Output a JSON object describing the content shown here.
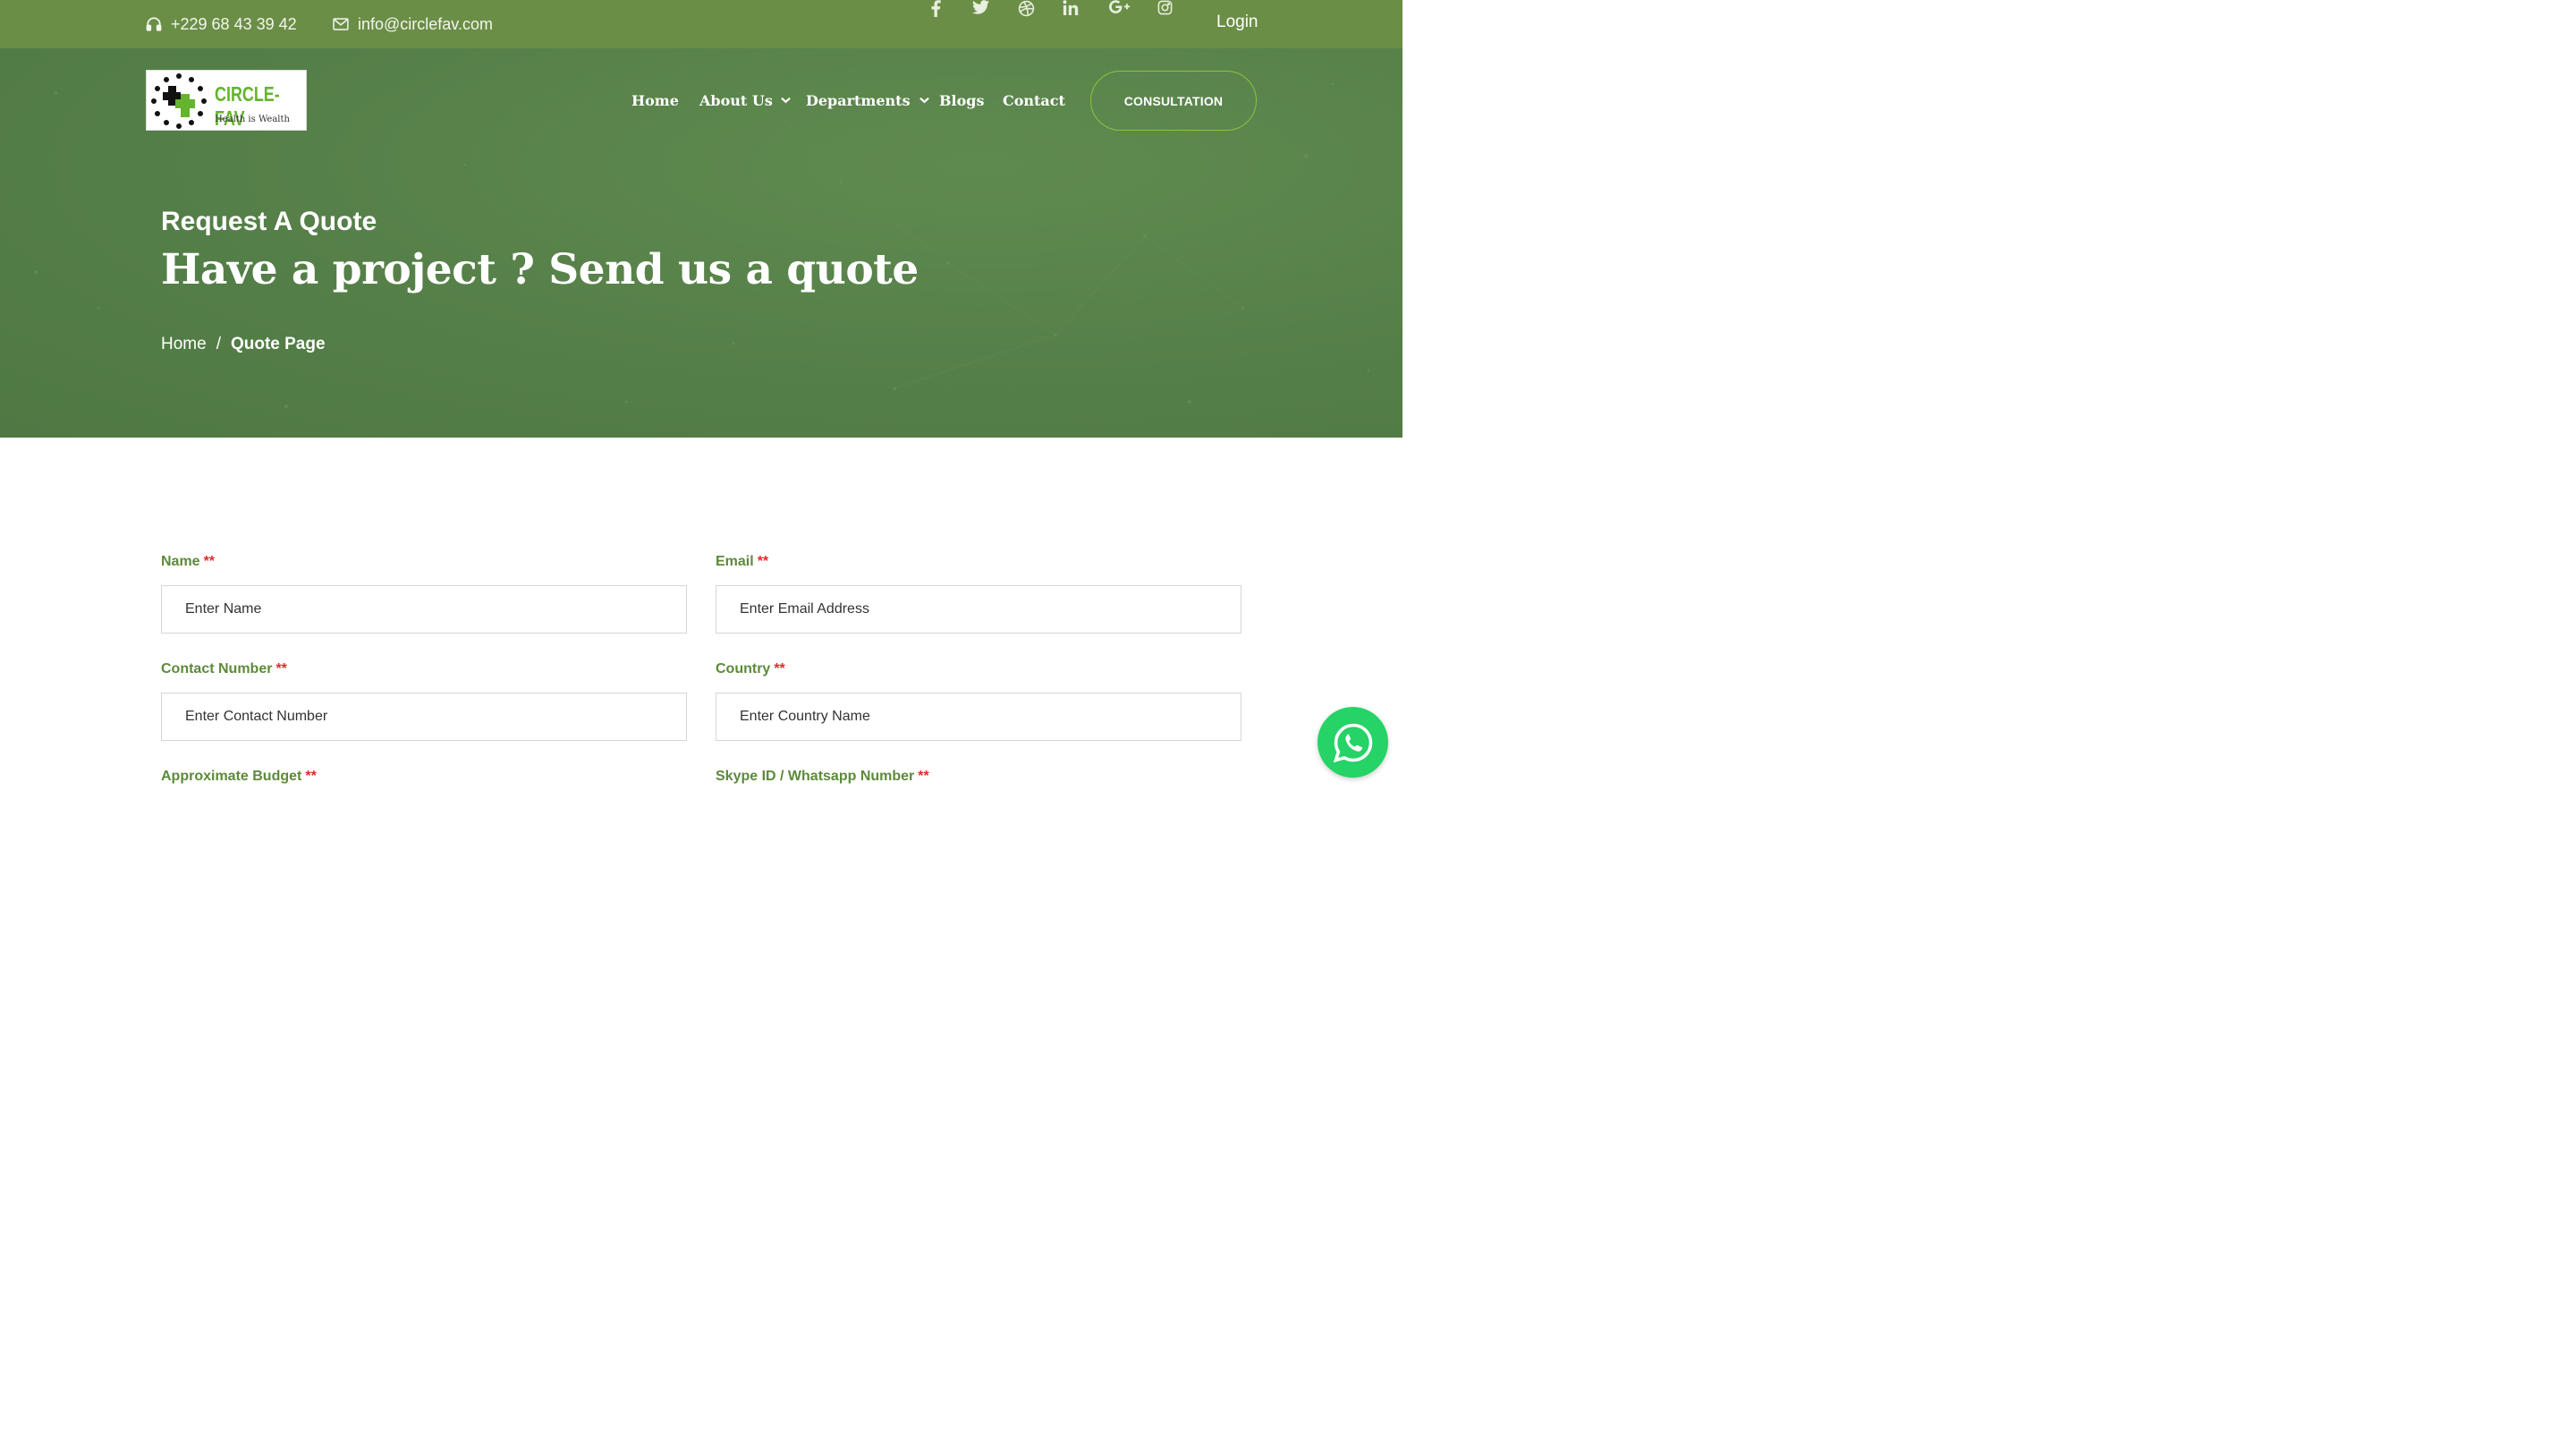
{
  "topbar": {
    "phone": "+229 68 43 39 42",
    "email": "info@circlefav.com",
    "social": [
      "facebook-icon",
      "twitter-icon",
      "dribbble-icon",
      "linkedin-icon",
      "google-plus-icon",
      "instagram-icon"
    ],
    "login_label": "Login"
  },
  "logo": {
    "brand": "CIRCLE-FAV",
    "tagline": "Health is Wealth"
  },
  "nav": {
    "items": [
      {
        "label": "Home"
      },
      {
        "label": "About Us"
      },
      {
        "label": "Departments"
      },
      {
        "label": "Blogs"
      },
      {
        "label": "Contact"
      }
    ],
    "cta_label": "CONSULTATION"
  },
  "hero": {
    "subtitle": "Request A Quote",
    "title": "Have a project ? Send us a quote",
    "breadcrumb": {
      "home": "Home",
      "separator": "/",
      "current": "Quote Page"
    }
  },
  "form": {
    "required_mark": "**",
    "name": {
      "label": "Name",
      "placeholder": "Enter Name"
    },
    "email": {
      "label": "Email",
      "placeholder": "Enter Email Address"
    },
    "contact": {
      "label": "Contact Number",
      "placeholder": "Enter Contact Number"
    },
    "country": {
      "label": "Country",
      "placeholder": "Enter Country Name"
    },
    "budget": {
      "label": "Approximate Budget"
    },
    "skype": {
      "label": "Skype ID / Whatsapp Number"
    }
  },
  "colors": {
    "topbar": "#6b8e46",
    "hero": "#567f48",
    "accent": "#8cc43f",
    "label": "#5d8a3a",
    "required": "#e02b2b",
    "whatsapp": "#25d366"
  }
}
